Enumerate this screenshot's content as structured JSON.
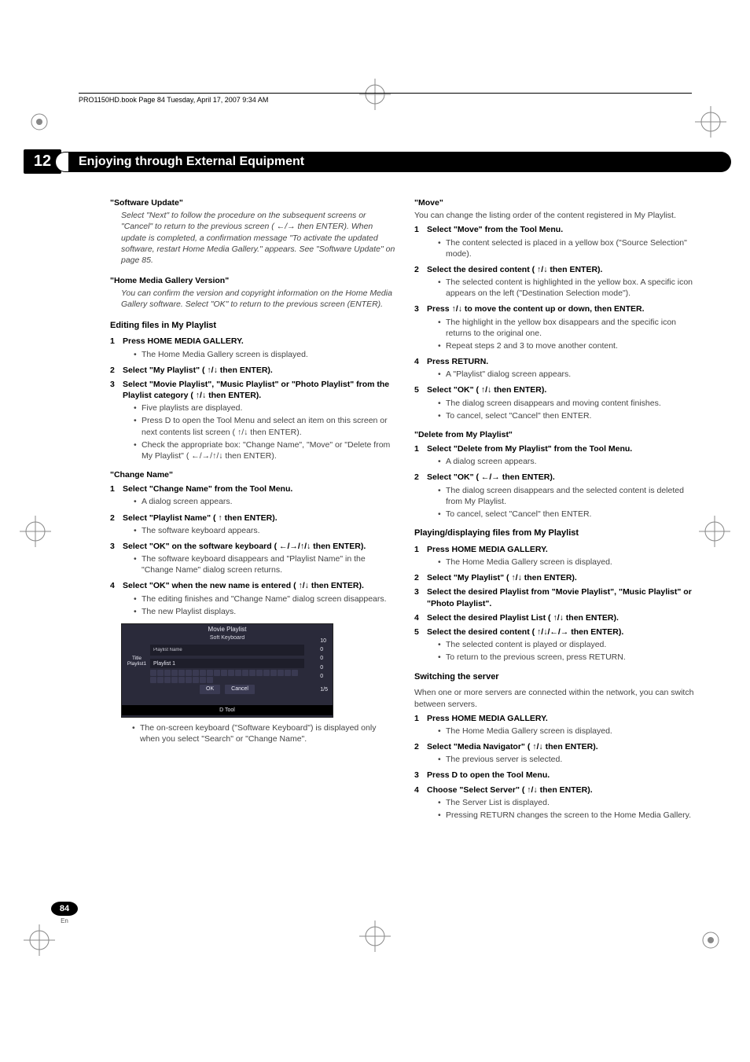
{
  "topline": "PRO1150HD.book  Page 84  Tuesday, April 17, 2007  9:34 AM",
  "chapter": {
    "number": "12",
    "title": "Enjoying through External Equipment"
  },
  "left": {
    "softwareUpdate": {
      "heading": "\"Software Update\"",
      "body": "Select \"Next\" to follow the procedure on the subsequent screens or \"Cancel\" to return to the previous screen ( ←/→ then ENTER). When update is completed, a confirmation message \"To activate the updated software, restart Home Media Gallery.\" appears. See \"Software Update\" on page 85."
    },
    "hmgVersion": {
      "heading": "\"Home Media Gallery Version\"",
      "body": "You can confirm the version and copyright information on the Home Media Gallery software. Select \"OK\" to return to the previous screen (ENTER)."
    },
    "editingTitle": "Editing files in My Playlist",
    "steps": [
      {
        "n": "1",
        "t": "Press HOME MEDIA GALLERY.",
        "subs": [
          "The Home Media Gallery screen is displayed."
        ]
      },
      {
        "n": "2",
        "t": "Select \"My Playlist\" ( ↑/↓ then ENTER).",
        "subs": []
      },
      {
        "n": "3",
        "t": "Select \"Movie Playlist\", \"Music Playlist\" or \"Photo Playlist\" from the Playlist category ( ↑/↓ then ENTER).",
        "subs": [
          "Five playlists are displayed.",
          "Press D to open the Tool Menu and select an item on this screen or next contents list screen ( ↑/↓ then ENTER).",
          "Check the appropriate box: \"Change Name\", \"Move\" or \"Delete from My Playlist\" ( ←/→/↑/↓ then ENTER)."
        ]
      }
    ],
    "changeName": {
      "heading": "\"Change Name\"",
      "steps": [
        {
          "n": "1",
          "t": "Select \"Change Name\" from the Tool Menu.",
          "subs": [
            "A dialog screen appears."
          ]
        },
        {
          "n": "2",
          "t": "Select \"Playlist Name\" ( ↑ then ENTER).",
          "subs": [
            "The software keyboard appears."
          ]
        },
        {
          "n": "3",
          "t": "Select \"OK\" on the software keyboard ( ←/→/↑/↓ then ENTER).",
          "subs": [
            "The software keyboard disappears and \"Playlist Name\" in the \"Change Name\" dialog screen returns."
          ]
        },
        {
          "n": "4",
          "t": "Select \"OK\" when the new name is entered ( ↑/↓ then ENTER).",
          "subs": [
            "The editing finishes and \"Change Name\" dialog screen disappears.",
            "The new Playlist displays."
          ]
        }
      ]
    },
    "uiShot": {
      "title": "Movie Playlist",
      "subtitle": "Soft Keyboard",
      "panelLabel": "Playlist Name",
      "panelValue": "Playlist 1",
      "sidebar": "Title Playlist1",
      "ok": "OK",
      "cancel": "Cancel",
      "footer": "D Tool",
      "count": "10",
      "zeros": [
        "0",
        "0",
        "0",
        "0"
      ],
      "frac": "1/5"
    },
    "noteAfterShot": "The on-screen keyboard (\"Software Keyboard\") is displayed only when you select \"Search\" or \"Change Name\"."
  },
  "right": {
    "move": {
      "heading": "\"Move\"",
      "intro": "You can change the listing order of the content registered in My Playlist.",
      "steps": [
        {
          "n": "1",
          "t": "Select \"Move\" from the Tool Menu.",
          "subs": [
            "The content selected is placed in a yellow box (\"Source Selection\" mode)."
          ]
        },
        {
          "n": "2",
          "t": "Select the desired content ( ↑/↓ then ENTER).",
          "subs": [
            "The selected content is highlighted in the yellow box. A specific icon appears on the left (\"Destination Selection mode\")."
          ]
        },
        {
          "n": "3",
          "t": "Press ↑/↓ to move the content up or down, then ENTER.",
          "subs": [
            "The highlight in the yellow box disappears and the specific icon returns to the original one.",
            "Repeat steps 2 and 3 to move another content."
          ]
        },
        {
          "n": "4",
          "t": "Press RETURN.",
          "subs": [
            "A \"Playlist\" dialog screen appears."
          ]
        },
        {
          "n": "5",
          "t": "Select \"OK\" ( ↑/↓ then ENTER).",
          "subs": [
            "The dialog screen disappears and moving content finishes.",
            "To cancel, select \"Cancel\" then ENTER."
          ]
        }
      ]
    },
    "delete": {
      "heading": "\"Delete from My Playlist\"",
      "steps": [
        {
          "n": "1",
          "t": "Select \"Delete from My Playlist\" from the Tool Menu.",
          "subs": [
            "A dialog screen appears."
          ]
        },
        {
          "n": "2",
          "t": "Select \"OK\" ( ←/→ then ENTER).",
          "subs": [
            "The dialog screen disappears and the selected content is deleted from My Playlist.",
            "To cancel, select \"Cancel\" then ENTER."
          ]
        }
      ]
    },
    "playing": {
      "title": "Playing/displaying files from My Playlist",
      "steps": [
        {
          "n": "1",
          "t": "Press HOME MEDIA GALLERY.",
          "subs": [
            "The Home Media Gallery screen is displayed."
          ]
        },
        {
          "n": "2",
          "t": "Select \"My Playlist\" ( ↑/↓ then ENTER).",
          "subs": []
        },
        {
          "n": "3",
          "t": "Select the desired Playlist from \"Movie Playlist\", \"Music Playlist\" or \"Photo Playlist\".",
          "subs": []
        },
        {
          "n": "4",
          "t": "Select the desired Playlist List ( ↑/↓ then ENTER).",
          "subs": []
        },
        {
          "n": "5",
          "t": "Select the desired content ( ↑/↓/←/→ then ENTER).",
          "subs": [
            "The selected content is played or displayed.",
            "To return to the previous screen, press RETURN."
          ]
        }
      ]
    },
    "switching": {
      "title": "Switching the server",
      "intro": "When one or more servers are connected within the network, you can switch between servers.",
      "steps": [
        {
          "n": "1",
          "t": "Press HOME MEDIA GALLERY.",
          "subs": [
            "The Home Media Gallery screen is displayed."
          ]
        },
        {
          "n": "2",
          "t": "Select \"Media Navigator\" ( ↑/↓ then ENTER).",
          "subs": [
            "The previous server is selected."
          ]
        },
        {
          "n": "3",
          "t": "Press D to open the Tool Menu.",
          "subs": []
        },
        {
          "n": "4",
          "t": "Choose \"Select Server\" ( ↑/↓ then ENTER).",
          "subs": [
            "The Server List is displayed.",
            "Pressing RETURN changes the screen to the Home Media Gallery."
          ]
        }
      ]
    }
  },
  "page": {
    "num": "84",
    "lang": "En"
  }
}
